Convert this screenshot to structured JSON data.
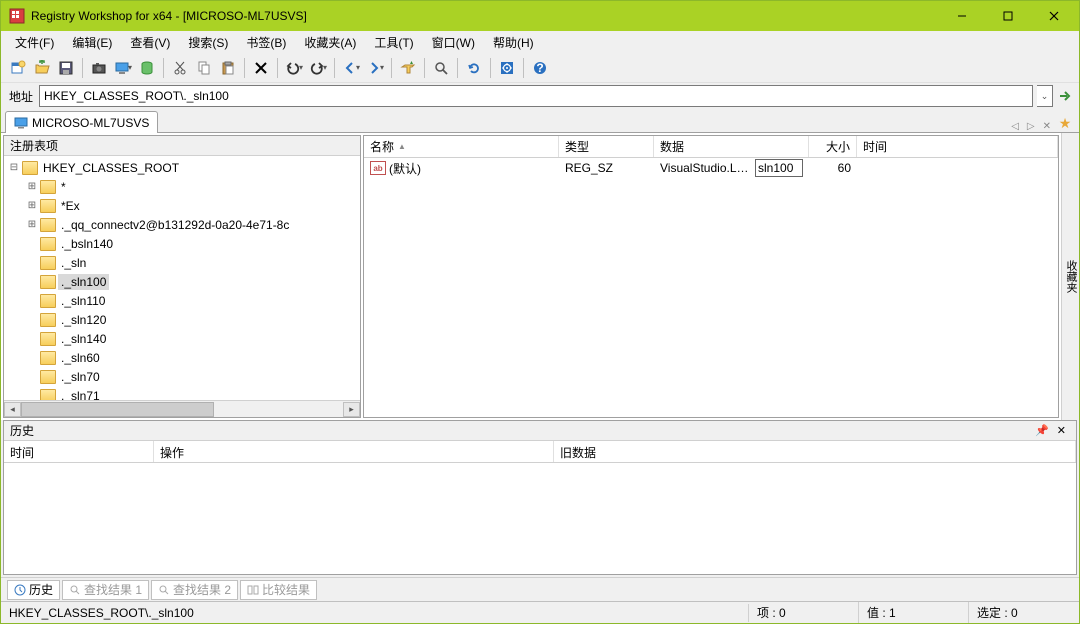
{
  "titlebar": {
    "title": "Registry Workshop for x64 - [MICROSO-ML7USVS]"
  },
  "menus": {
    "file": "文件(F)",
    "edit": "编辑(E)",
    "view": "查看(V)",
    "search": "搜索(S)",
    "bookmark": "书签(B)",
    "favorites": "收藏夹(A)",
    "tools": "工具(T)",
    "window": "窗口(W)",
    "help": "帮助(H)"
  },
  "address": {
    "label": "地址",
    "value": "HKEY_CLASSES_ROOT\\._sln100"
  },
  "tab": {
    "label": "MICROSO-ML7USVS"
  },
  "sidebar_label": "收藏夹",
  "tree": {
    "header": "注册表项",
    "root": "HKEY_CLASSES_ROOT",
    "items": [
      {
        "label": "*",
        "expandable": true
      },
      {
        "label": "*Ex",
        "expandable": true
      },
      {
        "label": "._qq_connectv2@b131292d-0a20-4e71-8c",
        "expandable": true
      },
      {
        "label": "._bsln140",
        "expandable": false
      },
      {
        "label": "._sln",
        "expandable": false
      },
      {
        "label": "._sln100",
        "expandable": false,
        "selected": true
      },
      {
        "label": "._sln110",
        "expandable": false
      },
      {
        "label": "._sln120",
        "expandable": false
      },
      {
        "label": "._sln140",
        "expandable": false
      },
      {
        "label": "._sln60",
        "expandable": false
      },
      {
        "label": "._sln70",
        "expandable": false
      },
      {
        "label": "._sln71",
        "expandable": false
      }
    ]
  },
  "list": {
    "cols": {
      "name": "名称",
      "type": "类型",
      "data": "数据",
      "size": "大小",
      "time": "时间"
    },
    "row": {
      "name": "(默认)",
      "type": "REG_SZ",
      "data_display": "VisualStudio.Launcher.",
      "data_edit": "sln100",
      "size": "60"
    }
  },
  "history": {
    "title": "历史",
    "cols": {
      "time": "时间",
      "op": "操作",
      "old": "旧数据"
    }
  },
  "bottomtabs": {
    "history": "历史",
    "find1": "查找结果 1",
    "find2": "查找结果 2",
    "compare": "比较结果"
  },
  "status": {
    "path": "HKEY_CLASSES_ROOT\\._sln100",
    "items": "项 : 0",
    "values": "值 : 1",
    "selected": "选定 : 0"
  }
}
